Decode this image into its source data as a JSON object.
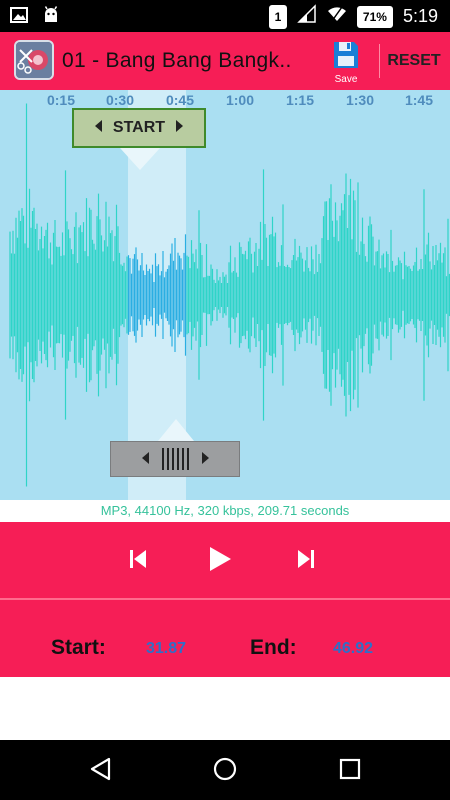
{
  "status": {
    "sim": "1",
    "battery": "71%",
    "time": "5:19"
  },
  "appbar": {
    "title": "01 - Bang Bang Bangk..",
    "save_label": "Save",
    "reset_label": "RESET"
  },
  "timeline": {
    "ticks": [
      "0:15",
      "0:30",
      "0:45",
      "1:00",
      "1:15",
      "1:30",
      "1:45"
    ]
  },
  "markers": {
    "start_label": "START"
  },
  "info": "MP3, 44100 Hz, 320 kbps, 209.71 seconds",
  "times": {
    "start_label": "Start:",
    "start_value": "31.87",
    "end_label": "End:",
    "end_value": "46.92"
  },
  "colors": {
    "accent": "#f61e56",
    "wave": "#22d3c4",
    "wave_selected": "#1aa8e0",
    "wave_bg": "#aadff2"
  },
  "icons": {
    "statusbar": [
      "gallery-icon",
      "android-icon",
      "sim-icon",
      "signal-icon",
      "wifi-icon",
      "battery-icon"
    ],
    "controls": [
      "skip-previous-icon",
      "play-icon",
      "skip-next-icon"
    ],
    "navbar": [
      "back-icon",
      "home-icon",
      "recents-icon"
    ]
  }
}
